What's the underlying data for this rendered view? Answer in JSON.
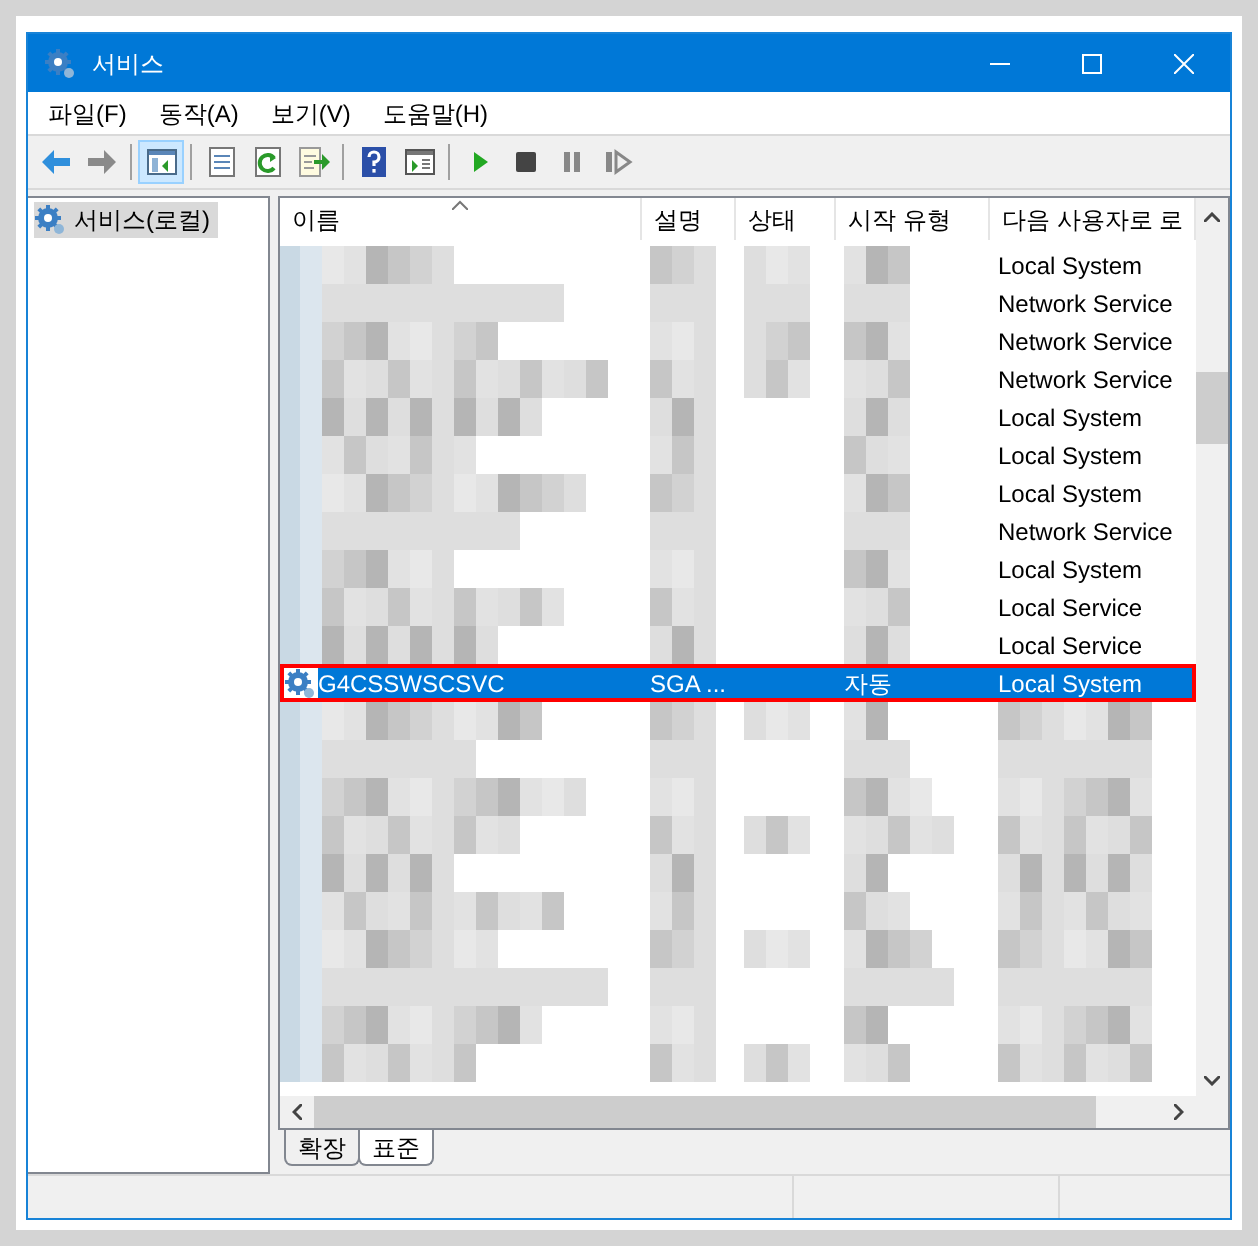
{
  "window": {
    "title": "서비스"
  },
  "menu": [
    {
      "label": "파일(F)"
    },
    {
      "label": "동작(A)"
    },
    {
      "label": "보기(V)"
    },
    {
      "label": "도움말(H)"
    }
  ],
  "toolbar": [
    {
      "kind": "back",
      "pressed": false
    },
    {
      "kind": "forward",
      "pressed": false
    },
    {
      "kind": "separator"
    },
    {
      "kind": "tree",
      "pressed": true
    },
    {
      "kind": "separator"
    },
    {
      "kind": "properties",
      "pressed": false
    },
    {
      "kind": "refresh",
      "pressed": false
    },
    {
      "kind": "export",
      "pressed": false
    },
    {
      "kind": "separator"
    },
    {
      "kind": "help",
      "pressed": false
    },
    {
      "kind": "view",
      "pressed": false
    },
    {
      "kind": "separator"
    },
    {
      "kind": "play",
      "pressed": false
    },
    {
      "kind": "stop",
      "pressed": false
    },
    {
      "kind": "pause",
      "pressed": false
    },
    {
      "kind": "resume",
      "pressed": false
    }
  ],
  "tree": {
    "items": [
      {
        "label": "서비스(로컬)",
        "selected": true
      }
    ]
  },
  "table": {
    "columns": [
      "이름",
      "설명",
      "상태",
      "시작 유형",
      "다음 사용자로 로"
    ],
    "rows": [
      {
        "kind": "service",
        "log_on": "Local System",
        "selected": false,
        "outlined": false
      },
      {
        "kind": "service",
        "log_on": "Network Service",
        "selected": false,
        "outlined": false
      },
      {
        "kind": "service",
        "log_on": "Network Service",
        "selected": false,
        "outlined": false
      },
      {
        "kind": "service",
        "log_on": "Network Service",
        "selected": false,
        "outlined": false
      },
      {
        "kind": "service",
        "log_on": "Local System",
        "selected": false,
        "outlined": false
      },
      {
        "kind": "service",
        "log_on": "Local System",
        "selected": false,
        "outlined": false
      },
      {
        "kind": "service",
        "log_on": "Local System",
        "selected": false,
        "outlined": false
      },
      {
        "kind": "service",
        "log_on": "Network Service",
        "selected": false,
        "outlined": false
      },
      {
        "kind": "service",
        "log_on": "Local System",
        "selected": false,
        "outlined": false
      },
      {
        "kind": "service",
        "log_on": "Local Service",
        "selected": false,
        "outlined": false
      },
      {
        "kind": "service",
        "log_on": "Local Service",
        "selected": false,
        "outlined": false
      },
      {
        "kind": "service",
        "name": "G4CSSWSCSVC",
        "description": "SGA ...",
        "startup_type": "자동",
        "log_on": "Local System",
        "selected": true,
        "outlined": true
      },
      {
        "kind": "obscured",
        "selected": false,
        "outlined": false
      },
      {
        "kind": "obscured",
        "selected": false,
        "outlined": false
      },
      {
        "kind": "obscured",
        "selected": false,
        "outlined": false
      },
      {
        "kind": "obscured",
        "selected": false,
        "outlined": false
      },
      {
        "kind": "obscured",
        "selected": false,
        "outlined": false
      },
      {
        "kind": "obscured",
        "selected": false,
        "outlined": false
      },
      {
        "kind": "obscured",
        "selected": false,
        "outlined": false
      },
      {
        "kind": "obscured",
        "selected": false,
        "outlined": false
      },
      {
        "kind": "obscured",
        "selected": false,
        "outlined": false
      },
      {
        "kind": "obscured",
        "selected": false,
        "outlined": false
      }
    ]
  },
  "view_tabs": [
    {
      "label": "확장",
      "selected": false
    },
    {
      "label": "표준",
      "selected": true
    }
  ]
}
